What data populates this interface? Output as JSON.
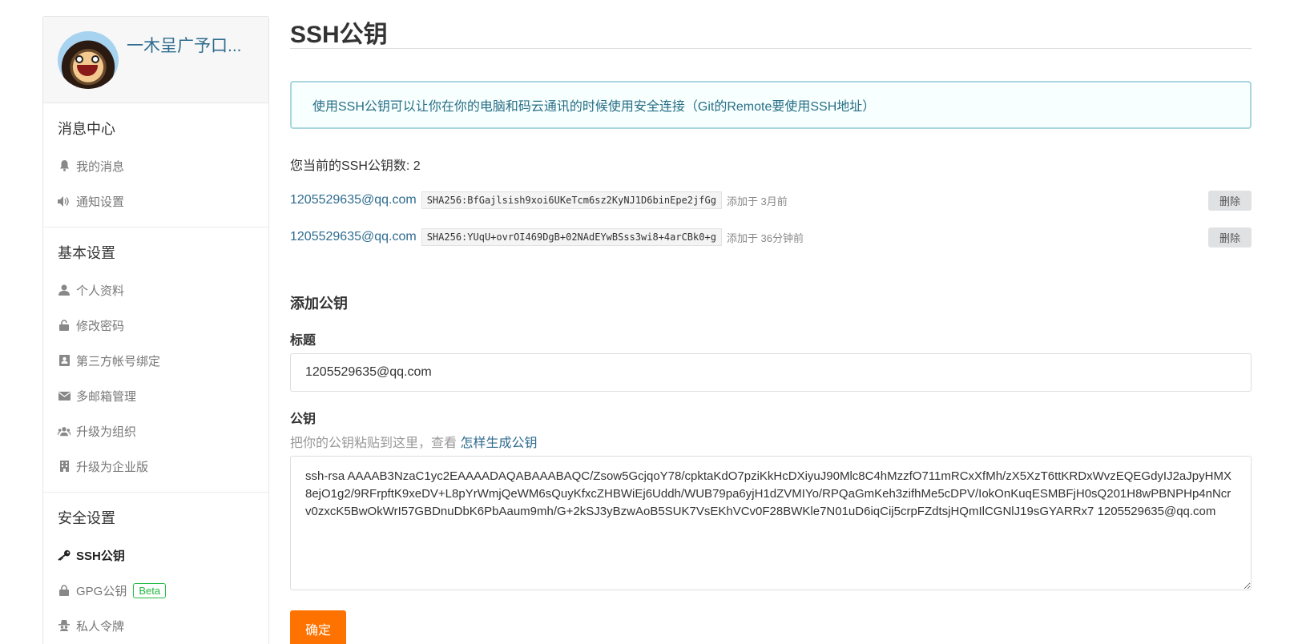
{
  "sidebar": {
    "profile_name": "一木呈广予口...",
    "sections": [
      {
        "title": "消息中心",
        "items": [
          {
            "label": "我的消息",
            "icon": "bell-icon"
          },
          {
            "label": "通知设置",
            "icon": "volume-icon"
          }
        ]
      },
      {
        "title": "基本设置",
        "items": [
          {
            "label": "个人资料",
            "icon": "user-icon"
          },
          {
            "label": "修改密码",
            "icon": "unlock-icon"
          },
          {
            "label": "第三方帐号绑定",
            "icon": "contact-card-icon"
          },
          {
            "label": "多邮箱管理",
            "icon": "envelope-icon"
          },
          {
            "label": "升级为组织",
            "icon": "users-icon"
          },
          {
            "label": "升级为企业版",
            "icon": "building-icon"
          }
        ]
      },
      {
        "title": "安全设置",
        "items": [
          {
            "label": "SSH公钥",
            "icon": "key-icon"
          },
          {
            "label": "GPG公钥",
            "icon": "lock-icon",
            "badge": "Beta"
          },
          {
            "label": "私人令牌",
            "icon": "spy-icon"
          }
        ]
      }
    ]
  },
  "main": {
    "title": "SSH公钥",
    "info": "使用SSH公钥可以让你在你的电脑和码云通讯的时候使用安全连接（Git的Remote要使用SSH地址）",
    "key_count": "您当前的SSH公钥数: 2",
    "keys": [
      {
        "email": "1205529635@qq.com",
        "fingerprint": "SHA256:BfGajlsish9xoi6UKeTcm6sz2KyNJ1D6binEpe2jfGg",
        "added": "添加于 3月前",
        "delete_label": "删除"
      },
      {
        "email": "1205529635@qq.com",
        "fingerprint": "SHA256:YUqU+ovrOI469DgB+02NAdEYwBSss3wi8+4arCBk0+g",
        "added": "添加于 36分钟前",
        "delete_label": "删除"
      }
    ],
    "add_title": "添加公钥",
    "title_label": "标题",
    "title_value": "1205529635@qq.com",
    "pubkey_label": "公钥",
    "pubkey_hint": "把你的公钥粘贴到这里，查看",
    "pubkey_hint_link": "怎样生成公钥",
    "pubkey_value": "ssh-rsa AAAAB3NzaC1yc2EAAAADAQABAAABAQC/Zsow5GcjqoY78/cpktaKdO7pziKkHcDXiyuJ90Mlc8C4hMzzfO711mRCxXfMh/zX5XzT6ttKRDxWvzEQEGdyIJ2aJpyHMX8ejO1g2/9RFrpftK9xeDV+L8pYrWmjQeWM6sQuyKfxcZHBWiEj6Uddh/WUB79pa6yjH1dZVMIYo/RPQaGmKeh3zifhMe5cDPV/IokOnKuqESMBFjH0sQ201H8wPBNPHp4nNcrv0zxcK5BwOkWrI57GBDnuDbK6PbAaum9mh/G+2kSJ3yBzwAoB5SUK7VsEKhVCv0F28BWKle7N01uD6iqCij5crpFZdtsjHQmIlCGNlJ19sGYARRx7 1205529635@qq.com",
    "submit_label": "确定"
  }
}
